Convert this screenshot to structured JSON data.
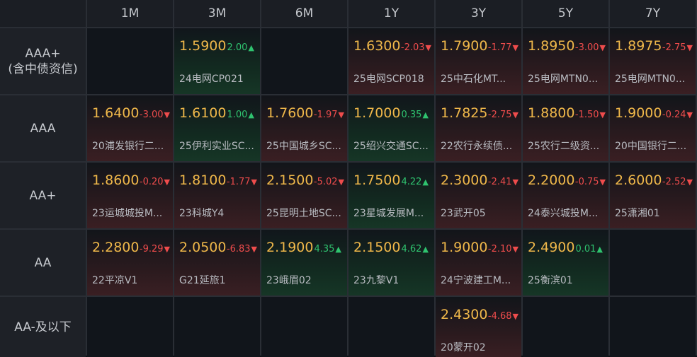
{
  "columns": [
    "1M",
    "3M",
    "6M",
    "1Y",
    "3Y",
    "5Y",
    "7Y"
  ],
  "rows": [
    {
      "label_lines": [
        "AAA+",
        "(含中债资信)"
      ],
      "cells": [
        null,
        {
          "yield": "1.5900",
          "change": "2.00",
          "dir": "up",
          "name": "24电网CP021"
        },
        null,
        {
          "yield": "1.6300",
          "change": "-2.03",
          "dir": "down",
          "name": "25电网SCP018"
        },
        {
          "yield": "1.7900",
          "change": "-1.77",
          "dir": "down",
          "name": "25中石化MT..."
        },
        {
          "yield": "1.8950",
          "change": "-3.00",
          "dir": "down",
          "name": "25电网MTN0..."
        },
        {
          "yield": "1.8975",
          "change": "-2.75",
          "dir": "down",
          "name": "25电网MTN0..."
        }
      ]
    },
    {
      "label_lines": [
        "AAA"
      ],
      "cells": [
        {
          "yield": "1.6400",
          "change": "-3.00",
          "dir": "down",
          "name": "20浦发银行二..."
        },
        {
          "yield": "1.6100",
          "change": "1.00",
          "dir": "up",
          "name": "25伊利实业SC..."
        },
        {
          "yield": "1.7600",
          "change": "-1.97",
          "dir": "down",
          "name": "25中国城乡SC..."
        },
        {
          "yield": "1.7000",
          "change": "0.35",
          "dir": "up",
          "name": "25绍兴交通SC..."
        },
        {
          "yield": "1.7825",
          "change": "-2.75",
          "dir": "down",
          "name": "22农行永续债..."
        },
        {
          "yield": "1.8800",
          "change": "-1.50",
          "dir": "down",
          "name": "25农行二级资..."
        },
        {
          "yield": "1.9000",
          "change": "-0.24",
          "dir": "down",
          "name": "20中国银行二..."
        }
      ]
    },
    {
      "label_lines": [
        "AA+"
      ],
      "cells": [
        {
          "yield": "1.8600",
          "change": "-0.20",
          "dir": "down",
          "name": "23运城城投M..."
        },
        {
          "yield": "1.8100",
          "change": "-1.77",
          "dir": "down",
          "name": "23科城Y4"
        },
        {
          "yield": "2.1500",
          "change": "-5.02",
          "dir": "down",
          "name": "25昆明土地SC..."
        },
        {
          "yield": "1.7500",
          "change": "4.22",
          "dir": "up",
          "name": "23星城发展M..."
        },
        {
          "yield": "2.3000",
          "change": "-2.41",
          "dir": "down",
          "name": "23武开05"
        },
        {
          "yield": "2.2000",
          "change": "-0.75",
          "dir": "down",
          "name": "24泰兴城投M..."
        },
        {
          "yield": "2.6000",
          "change": "-2.52",
          "dir": "down",
          "name": "25潇湘01"
        }
      ]
    },
    {
      "label_lines": [
        "AA"
      ],
      "cells": [
        {
          "yield": "2.2800",
          "change": "-9.29",
          "dir": "down",
          "name": "22平凉V1"
        },
        {
          "yield": "2.0500",
          "change": "-6.83",
          "dir": "down",
          "name": "G21延旅1"
        },
        {
          "yield": "2.1900",
          "change": "4.35",
          "dir": "up",
          "name": "23峨眉02"
        },
        {
          "yield": "2.1500",
          "change": "4.62",
          "dir": "up",
          "name": "23九黎V1"
        },
        {
          "yield": "1.9000",
          "change": "-2.10",
          "dir": "down",
          "name": "24宁波建工M..."
        },
        {
          "yield": "2.4900",
          "change": "0.01",
          "dir": "up",
          "name": "25衡滨01"
        },
        null
      ]
    },
    {
      "label_lines": [
        "AA-及以下"
      ],
      "cells": [
        null,
        null,
        null,
        null,
        {
          "yield": "2.4300",
          "change": "-4.68",
          "dir": "down",
          "name": "20蒙开02"
        },
        null,
        null
      ]
    }
  ],
  "icons": {
    "up": "triangle-up-icon",
    "down": "triangle-down-icon"
  },
  "colors": {
    "yield": "#f0b84a",
    "up": "#2fc36f",
    "down": "#ee4c4c"
  }
}
